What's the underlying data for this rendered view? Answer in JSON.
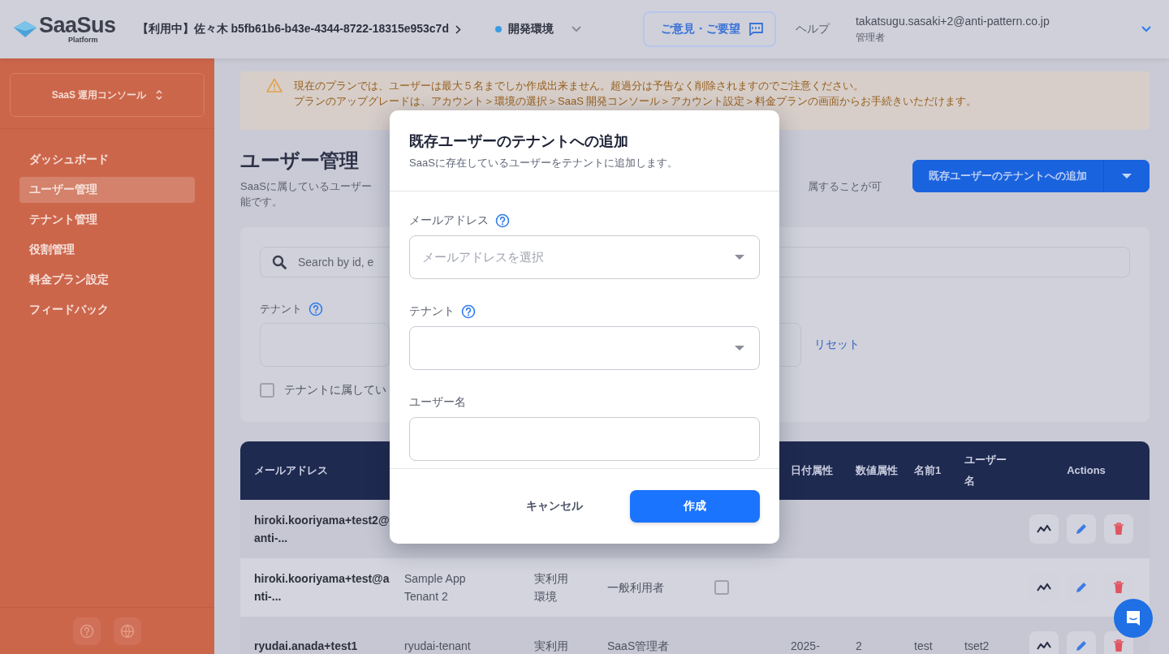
{
  "header": {
    "logo": {
      "name": "SaaSus",
      "sub": "Platform"
    },
    "context": "【利用中】佐々木 b5fb61b6-b43e-4344-8722-18315e953c7d",
    "environment": "開発環境",
    "feedback_button": "ご意見・ご要望",
    "help_link": "ヘルプ",
    "user": {
      "email": "takatsugu.sasaki+2@anti-pattern.co.jp",
      "role": "管理者"
    }
  },
  "sidebar": {
    "console_selector": "SaaS 運用コンソール",
    "items": [
      {
        "label": "ダッシュボード",
        "selected": false
      },
      {
        "label": "ユーザー管理",
        "selected": true
      },
      {
        "label": "テナント管理",
        "selected": false
      },
      {
        "label": "役割管理",
        "selected": false
      },
      {
        "label": "料金プラン設定",
        "selected": false
      },
      {
        "label": "フィードバック",
        "selected": false
      }
    ]
  },
  "banner": {
    "lines": [
      "現在のプランでは、ユーザーは最大５名までしか作成出来ません。超過分は予告なく削除されますのでご注意ください。",
      "プランのアップグレードは、アカウント＞環境の選択＞SaaS 開発コンソール＞アカウント設定＞料金プランの画面からお手続きいただけます。"
    ]
  },
  "page": {
    "title": "ユーザー管理",
    "description_fragments": [
      "SaaSに属しているユーザー",
      "属することが可",
      "能です。"
    ],
    "primary_button": "既存ユーザーのテナントへの追加"
  },
  "filters": {
    "search_placeholder": "Search by id, e",
    "tenant_label": "テナント",
    "reset_link": "リセット",
    "checkbox": {
      "label": "テナントに属してい",
      "checked": false
    }
  },
  "table": {
    "columns": [
      {
        "label": "メールアドレス"
      },
      {},
      {},
      {},
      {},
      {
        "label": "日付属性"
      },
      {
        "label": "数値属性"
      },
      {
        "label": "名前1"
      },
      {
        "label": "ユーザー名"
      },
      {
        "label": "Actions"
      }
    ],
    "rows": [
      {
        "cells": [
          "hiroki.kooriyama+test2@anti-...",
          null,
          null,
          null,
          null,
          null,
          null,
          null,
          null
        ]
      },
      {
        "cells": [
          "hiroki.kooriyama+test@anti-...",
          "Sample App Tenant 2",
          "実利用環境",
          "一般利用者",
          null,
          null,
          null,
          null,
          null
        ],
        "checkbox": {
          "checked": false
        }
      },
      {
        "cells": [
          "ryudai.anada+test1",
          "ryudai-tenant",
          "実利用",
          "SaaS管理者",
          null,
          "2025-",
          "2",
          "test",
          "tset2"
        ]
      }
    ]
  },
  "modal": {
    "title": "既存ユーザーのテナントへの追加",
    "subtitle": "SaaSに存在しているユーザーをテナントに追加します。",
    "fields": [
      {
        "label": "メールアドレス",
        "kind": "select",
        "help": true,
        "placeholder": "メールアドレスを選択"
      },
      {
        "label": "テナント",
        "kind": "select",
        "help": true
      },
      {
        "label": "ユーザー名",
        "kind": "text",
        "help": false
      }
    ],
    "cancel_button": "キャンセル",
    "submit_button": "作成"
  }
}
